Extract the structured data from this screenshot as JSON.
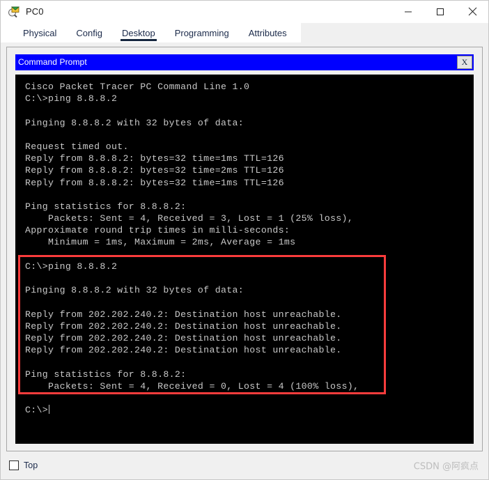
{
  "window": {
    "title": "PC0",
    "icon": "packet-tracer-pc-icon",
    "controls": {
      "minimize": "minimize-icon",
      "maximize": "maximize-icon",
      "close": "close-icon"
    }
  },
  "tabs": [
    {
      "label": "Physical",
      "active": false
    },
    {
      "label": "Config",
      "active": false
    },
    {
      "label": "Desktop",
      "active": true
    },
    {
      "label": "Programming",
      "active": false
    },
    {
      "label": "Attributes",
      "active": false
    }
  ],
  "command_prompt": {
    "title": "Command Prompt",
    "close_label": "X",
    "title_bar_color": "#0000ff",
    "background_color": "#000000",
    "text_color": "#c9c9c9",
    "lines": [
      "Cisco Packet Tracer PC Command Line 1.0",
      "C:\\>ping 8.8.8.2",
      "",
      "Pinging 8.8.8.2 with 32 bytes of data:",
      "",
      "Request timed out.",
      "Reply from 8.8.8.2: bytes=32 time=1ms TTL=126",
      "Reply from 8.8.8.2: bytes=32 time=2ms TTL=126",
      "Reply from 8.8.8.2: bytes=32 time=1ms TTL=126",
      "",
      "Ping statistics for 8.8.8.2:",
      "    Packets: Sent = 4, Received = 3, Lost = 1 (25% loss),",
      "Approximate round trip times in milli-seconds:",
      "    Minimum = 1ms, Maximum = 2ms, Average = 1ms",
      "",
      "C:\\>ping 8.8.8.2",
      "",
      "Pinging 8.8.8.2 with 32 bytes of data:",
      "",
      "Reply from 202.202.240.2: Destination host unreachable.",
      "Reply from 202.202.240.2: Destination host unreachable.",
      "Reply from 202.202.240.2: Destination host unreachable.",
      "Reply from 202.202.240.2: Destination host unreachable.",
      "",
      "Ping statistics for 8.8.8.2:",
      "    Packets: Sent = 4, Received = 0, Lost = 4 (100% loss),",
      "",
      "C:\\>"
    ]
  },
  "annotation": {
    "highlight_color": "#fa3c3c",
    "covers_lines": "second ping session from 'C:\\>ping 8.8.8.2' through '(100% loss),'"
  },
  "footer": {
    "top_checkbox_label": "Top",
    "top_checkbox_checked": false,
    "watermark": "CSDN @阿疯点"
  }
}
